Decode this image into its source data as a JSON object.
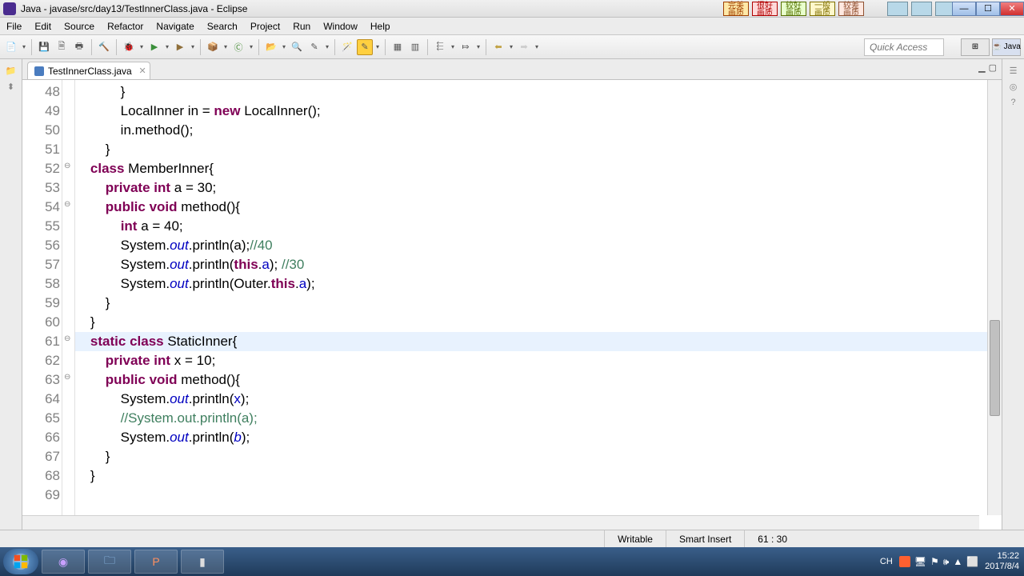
{
  "window": {
    "title": "Java - javase/src/day13/TestInnerClass.java - Eclipse"
  },
  "quality": {
    "q1": "完美\n画质",
    "q2": "很好\n画质",
    "q3": "较好\n画质",
    "q4": "一般\n画质",
    "q5": "较差\n画质"
  },
  "menu": [
    "File",
    "Edit",
    "Source",
    "Refactor",
    "Navigate",
    "Search",
    "Project",
    "Run",
    "Window",
    "Help"
  ],
  "quick_access_placeholder": "Quick Access",
  "perspective_label": "Java",
  "editor_tab": "TestInnerClass.java",
  "code_start_line": 48,
  "code": [
    {
      "i": "            }",
      "cls": ""
    },
    {
      "i": "            LocalInner in = <kw>new</kw> LocalInner();",
      "cls": ""
    },
    {
      "i": "            in.method();",
      "cls": ""
    },
    {
      "i": "        }",
      "cls": ""
    },
    {
      "i": "    <kw>class</kw> MemberInner{",
      "cls": "",
      "fold": true
    },
    {
      "i": "        <kw>private</kw> <kw>int</kw> a = 30;",
      "cls": ""
    },
    {
      "i": "        <kw>public</kw> <kw>void</kw> method(){",
      "cls": "",
      "fold": true
    },
    {
      "i": "            <kw>int</kw> a = 40;",
      "cls": ""
    },
    {
      "i": "            System.<static-f>out</static-f>.println(a);<comment>//40</comment>",
      "cls": ""
    },
    {
      "i": "            System.<static-f>out</static-f>.println(<kw>this</kw>.<field-ref>a</field-ref>); <comment>//30</comment>",
      "cls": ""
    },
    {
      "i": "            System.<static-f>out</static-f>.println(Outer.<kw>this</kw>.<field-ref>a</field-ref>);",
      "cls": ""
    },
    {
      "i": "        }",
      "cls": ""
    },
    {
      "i": "    }",
      "cls": ""
    },
    {
      "i": "    <kw>static</kw> <kw>class</kw> StaticInner{",
      "cls": "hl",
      "fold": true
    },
    {
      "i": "        <kw>private</kw> <kw>int</kw> x = 10;",
      "cls": ""
    },
    {
      "i": "        <kw>public</kw> <kw>void</kw> method(){",
      "cls": "",
      "fold": true
    },
    {
      "i": "            System.<static-f>out</static-f>.println(<field-ref>x</field-ref>);",
      "cls": ""
    },
    {
      "i": "            <comment>//System.out.println(a);</comment>",
      "cls": ""
    },
    {
      "i": "            System.<static-f>out</static-f>.println(<static-f>b</static-f>);",
      "cls": ""
    },
    {
      "i": "        }",
      "cls": ""
    },
    {
      "i": "    }",
      "cls": ""
    },
    {
      "i": "",
      "cls": ""
    }
  ],
  "status": {
    "writable": "Writable",
    "insert": "Smart Insert",
    "pos": "61 : 30"
  },
  "tray": {
    "ime": "CH",
    "time": "15:22",
    "date": "2017/8/4"
  }
}
